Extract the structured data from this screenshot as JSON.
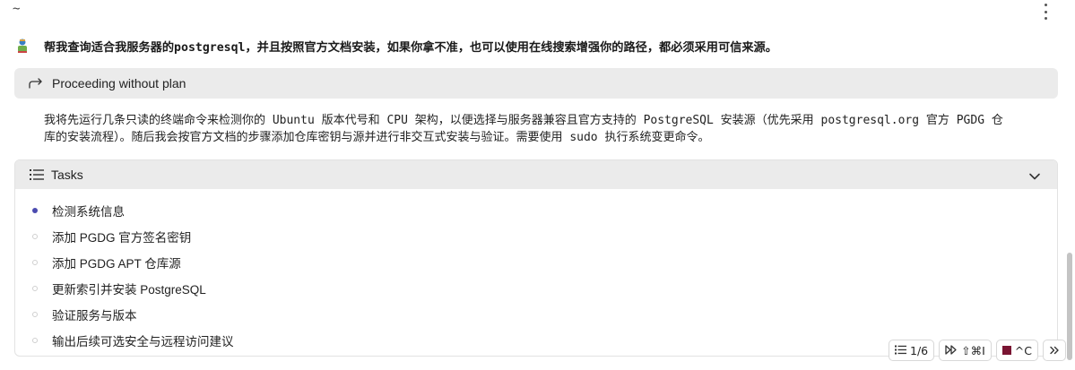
{
  "header": {
    "cwd": "~",
    "menu_icon": "more-vertical-icon"
  },
  "user_message": {
    "avatar_icon": "user-avatar-icon",
    "text": "帮我查询适合我服务器的postgresql，并且按照官方文档安装，如果你拿不准，也可以使用在线搜索增强你的路径，都必须采用可信来源。"
  },
  "plan_status": {
    "icon": "redo-arrow-icon",
    "label": "Proceeding without plan"
  },
  "assistant_message": {
    "line1": "我将先运行几条只读的终端命令来检测你的 Ubuntu 版本代号和 CPU 架构，以便选择与服务器兼容且官方支持的 PostgreSQL 安装源（优先采用 postgresql.org 官方 PGDG 仓",
    "line2": "库的安装流程）。随后我会按官方文档的步骤添加仓库密钥与源并进行非交互式安装与验证。需要使用 sudo 执行系统变更命令。"
  },
  "tasks": {
    "title": "Tasks",
    "icon": "list-icon",
    "toggle_icon": "chevron-down-icon",
    "items": [
      {
        "label": "检测系统信息",
        "status": "active"
      },
      {
        "label": "添加 PGDG 官方签名密钥",
        "status": "pending"
      },
      {
        "label": "添加 PGDG APT 仓库源",
        "status": "pending"
      },
      {
        "label": "更新索引并安装 PostgreSQL",
        "status": "pending"
      },
      {
        "label": "验证服务与版本",
        "status": "pending"
      },
      {
        "label": "输出后续可选安全与远程访问建议",
        "status": "pending"
      }
    ]
  },
  "bottom_bar": {
    "progress_label": "1/6",
    "skip_shortcut": "⇧⌘I",
    "stop_shortcut": "^C",
    "stop_color": "#7a1432",
    "expand_icon": "double-chevron-right-icon"
  },
  "colors": {
    "accent": "#4b4bb0",
    "bar_bg": "#ebebeb"
  }
}
